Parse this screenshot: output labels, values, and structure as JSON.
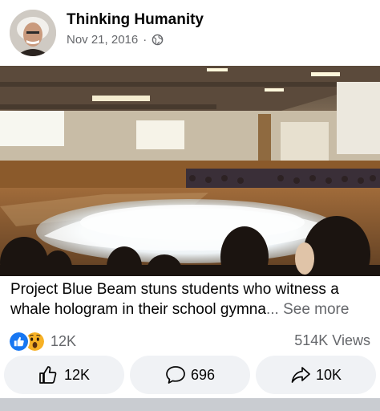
{
  "post": {
    "page_name": "Thinking Humanity",
    "date": "Nov 21, 2016",
    "separator": "·",
    "audience_icon": "globe-icon",
    "caption_text": "Project Blue Beam stuns students who witness a whale hologram in their school gymna",
    "caption_ellipsis": "...",
    "see_more_label": "See more"
  },
  "stats": {
    "reaction_icons": [
      "like-icon",
      "wow-icon"
    ],
    "reaction_count": "12K",
    "views": "514K Views"
  },
  "actions": {
    "like_count": "12K",
    "comment_count": "696",
    "share_count": "10K"
  },
  "colors": {
    "like_blue": "#1877f2",
    "wow_yellow": "#f7b125",
    "secondary_text": "#65676b",
    "button_bg": "#f0f2f5"
  }
}
